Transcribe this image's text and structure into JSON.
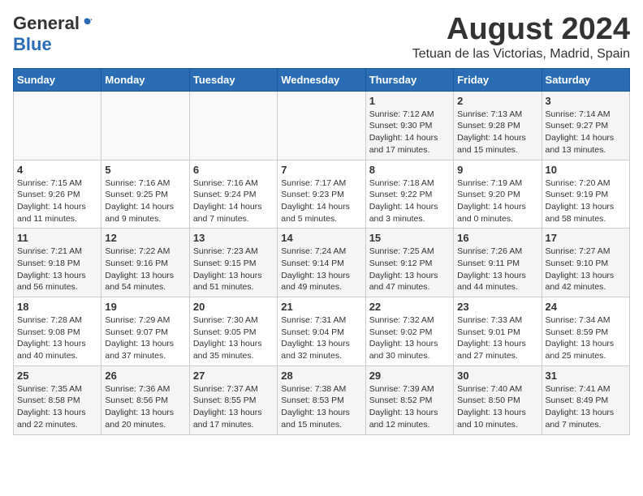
{
  "header": {
    "logo_general": "General",
    "logo_blue": "Blue",
    "month_title": "August 2024",
    "location": "Tetuan de las Victorias, Madrid, Spain"
  },
  "weekdays": [
    "Sunday",
    "Monday",
    "Tuesday",
    "Wednesday",
    "Thursday",
    "Friday",
    "Saturday"
  ],
  "weeks": [
    [
      {
        "day": "",
        "info": ""
      },
      {
        "day": "",
        "info": ""
      },
      {
        "day": "",
        "info": ""
      },
      {
        "day": "",
        "info": ""
      },
      {
        "day": "1",
        "info": "Sunrise: 7:12 AM\nSunset: 9:30 PM\nDaylight: 14 hours and 17 minutes."
      },
      {
        "day": "2",
        "info": "Sunrise: 7:13 AM\nSunset: 9:28 PM\nDaylight: 14 hours and 15 minutes."
      },
      {
        "day": "3",
        "info": "Sunrise: 7:14 AM\nSunset: 9:27 PM\nDaylight: 14 hours and 13 minutes."
      }
    ],
    [
      {
        "day": "4",
        "info": "Sunrise: 7:15 AM\nSunset: 9:26 PM\nDaylight: 14 hours and 11 minutes."
      },
      {
        "day": "5",
        "info": "Sunrise: 7:16 AM\nSunset: 9:25 PM\nDaylight: 14 hours and 9 minutes."
      },
      {
        "day": "6",
        "info": "Sunrise: 7:16 AM\nSunset: 9:24 PM\nDaylight: 14 hours and 7 minutes."
      },
      {
        "day": "7",
        "info": "Sunrise: 7:17 AM\nSunset: 9:23 PM\nDaylight: 14 hours and 5 minutes."
      },
      {
        "day": "8",
        "info": "Sunrise: 7:18 AM\nSunset: 9:22 PM\nDaylight: 14 hours and 3 minutes."
      },
      {
        "day": "9",
        "info": "Sunrise: 7:19 AM\nSunset: 9:20 PM\nDaylight: 14 hours and 0 minutes."
      },
      {
        "day": "10",
        "info": "Sunrise: 7:20 AM\nSunset: 9:19 PM\nDaylight: 13 hours and 58 minutes."
      }
    ],
    [
      {
        "day": "11",
        "info": "Sunrise: 7:21 AM\nSunset: 9:18 PM\nDaylight: 13 hours and 56 minutes."
      },
      {
        "day": "12",
        "info": "Sunrise: 7:22 AM\nSunset: 9:16 PM\nDaylight: 13 hours and 54 minutes."
      },
      {
        "day": "13",
        "info": "Sunrise: 7:23 AM\nSunset: 9:15 PM\nDaylight: 13 hours and 51 minutes."
      },
      {
        "day": "14",
        "info": "Sunrise: 7:24 AM\nSunset: 9:14 PM\nDaylight: 13 hours and 49 minutes."
      },
      {
        "day": "15",
        "info": "Sunrise: 7:25 AM\nSunset: 9:12 PM\nDaylight: 13 hours and 47 minutes."
      },
      {
        "day": "16",
        "info": "Sunrise: 7:26 AM\nSunset: 9:11 PM\nDaylight: 13 hours and 44 minutes."
      },
      {
        "day": "17",
        "info": "Sunrise: 7:27 AM\nSunset: 9:10 PM\nDaylight: 13 hours and 42 minutes."
      }
    ],
    [
      {
        "day": "18",
        "info": "Sunrise: 7:28 AM\nSunset: 9:08 PM\nDaylight: 13 hours and 40 minutes."
      },
      {
        "day": "19",
        "info": "Sunrise: 7:29 AM\nSunset: 9:07 PM\nDaylight: 13 hours and 37 minutes."
      },
      {
        "day": "20",
        "info": "Sunrise: 7:30 AM\nSunset: 9:05 PM\nDaylight: 13 hours and 35 minutes."
      },
      {
        "day": "21",
        "info": "Sunrise: 7:31 AM\nSunset: 9:04 PM\nDaylight: 13 hours and 32 minutes."
      },
      {
        "day": "22",
        "info": "Sunrise: 7:32 AM\nSunset: 9:02 PM\nDaylight: 13 hours and 30 minutes."
      },
      {
        "day": "23",
        "info": "Sunrise: 7:33 AM\nSunset: 9:01 PM\nDaylight: 13 hours and 27 minutes."
      },
      {
        "day": "24",
        "info": "Sunrise: 7:34 AM\nSunset: 8:59 PM\nDaylight: 13 hours and 25 minutes."
      }
    ],
    [
      {
        "day": "25",
        "info": "Sunrise: 7:35 AM\nSunset: 8:58 PM\nDaylight: 13 hours and 22 minutes."
      },
      {
        "day": "26",
        "info": "Sunrise: 7:36 AM\nSunset: 8:56 PM\nDaylight: 13 hours and 20 minutes."
      },
      {
        "day": "27",
        "info": "Sunrise: 7:37 AM\nSunset: 8:55 PM\nDaylight: 13 hours and 17 minutes."
      },
      {
        "day": "28",
        "info": "Sunrise: 7:38 AM\nSunset: 8:53 PM\nDaylight: 13 hours and 15 minutes."
      },
      {
        "day": "29",
        "info": "Sunrise: 7:39 AM\nSunset: 8:52 PM\nDaylight: 13 hours and 12 minutes."
      },
      {
        "day": "30",
        "info": "Sunrise: 7:40 AM\nSunset: 8:50 PM\nDaylight: 13 hours and 10 minutes."
      },
      {
        "day": "31",
        "info": "Sunrise: 7:41 AM\nSunset: 8:49 PM\nDaylight: 13 hours and 7 minutes."
      }
    ]
  ]
}
